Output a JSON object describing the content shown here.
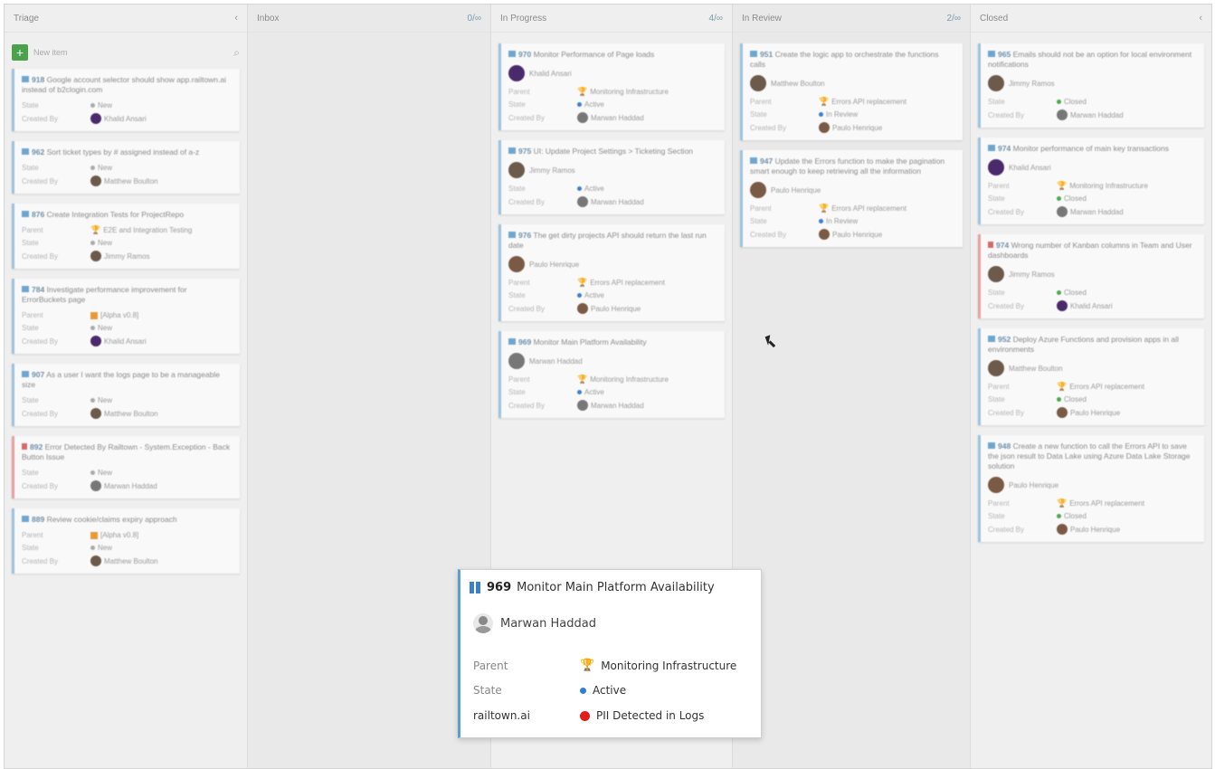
{
  "columns": [
    {
      "title": "Triage",
      "count": "",
      "chevron": "‹"
    },
    {
      "title": "Inbox",
      "count": "0/∞",
      "chevron": ""
    },
    {
      "title": "In Progress",
      "count": "4/∞",
      "chevron": ""
    },
    {
      "title": "In Review",
      "count": "2/∞",
      "chevron": ""
    },
    {
      "title": "Closed",
      "count": "",
      "chevron": "‹"
    }
  ],
  "new_item_label": "New item",
  "labels": {
    "parent": "Parent",
    "state": "State",
    "created_by": "Created By"
  },
  "triage_cards": [
    {
      "id": "918",
      "title": "Google account selector should show app.railtown.ai instead of b2clogin.com",
      "state": "New",
      "created_by": "Khalid Ansari"
    },
    {
      "id": "962",
      "title": "Sort ticket types by # assigned instead of a-z",
      "state": "New",
      "created_by": "Matthew Boulton"
    },
    {
      "id": "876",
      "title": "Create Integration Tests for ProjectRepo",
      "parent": "E2E and Integration Testing",
      "state": "New",
      "created_by": "Jimmy Ramos"
    },
    {
      "id": "784",
      "title": "Investigate performance improvement for ErrorBuckets page",
      "parent": "[Alpha v0.8]",
      "state": "New",
      "created_by": "Khalid Ansari"
    },
    {
      "id": "907",
      "title": "As a user I want the logs page to be a manageable size",
      "state": "New",
      "created_by": "Matthew Boulton"
    },
    {
      "id": "892",
      "title": "Error Detected By Railtown - System.Exception - Back Button Issue",
      "state": "New",
      "created_by": "Marwan Haddad",
      "bug": true
    },
    {
      "id": "889",
      "title": "Review cookie/claims expiry approach",
      "parent": "[Alpha v0.8]",
      "state": "New",
      "created_by": "Matthew Boulton"
    }
  ],
  "progress_cards": [
    {
      "id": "970",
      "title": "Monitor Performance of Page loads",
      "assignee": "Khalid Ansari",
      "parent": "Monitoring Infrastructure",
      "state": "Active",
      "created_by": "Marwan Haddad"
    },
    {
      "id": "975",
      "title": "UI: Update Project Settings > Ticketing Section",
      "assignee": "Jimmy Ramos",
      "state": "Active",
      "created_by": "Marwan Haddad"
    },
    {
      "id": "976",
      "title": "The get dirty projects API should return the last run date",
      "assignee": "Paulo Henrique",
      "parent": "Errors API replacement",
      "state": "Active",
      "created_by": "Paulo Henrique"
    },
    {
      "id": "969",
      "title": "Monitor Main Platform Availability",
      "assignee": "Marwan Haddad",
      "parent": "Monitoring Infrastructure",
      "state": "Active",
      "created_by": "Marwan Haddad"
    }
  ],
  "review_cards": [
    {
      "id": "951",
      "title": "Create the logic app to orchestrate the functions calls",
      "assignee": "Matthew Boulton",
      "parent": "Errors API replacement",
      "state": "In Review",
      "created_by": "Paulo Henrique"
    },
    {
      "id": "947",
      "title": "Update the Errors function to make the pagination smart enough to keep retrieving all the information",
      "assignee": "Paulo Henrique",
      "parent": "Errors API replacement",
      "state": "In Review",
      "created_by": "Paulo Henrique"
    }
  ],
  "closed_cards": [
    {
      "id": "965",
      "title": "Emails should not be an option for local environment notifications",
      "assignee": "Jimmy Ramos",
      "state": "Closed",
      "created_by": "Marwan Haddad"
    },
    {
      "id": "974",
      "title": "Monitor performance of main key transactions",
      "assignee": "Khalid Ansari",
      "parent": "Monitoring Infrastructure",
      "state": "Closed",
      "created_by": "Marwan Haddad"
    },
    {
      "id": "974",
      "title": "Wrong number of Kanban columns in Team and User dashboards",
      "assignee": "Jimmy Ramos",
      "state": "Closed",
      "created_by": "Khalid Ansari",
      "bug": true
    },
    {
      "id": "952",
      "title": "Deploy Azure Functions and provision apps in all environments",
      "assignee": "Matthew Boulton",
      "parent": "Errors API replacement",
      "state": "Closed",
      "created_by": "Paulo Henrique"
    },
    {
      "id": "948",
      "title": "Create a new function to call the Errors API to save the json result to Data Lake using Azure Data Lake Storage solution",
      "assignee": "Paulo Henrique",
      "parent": "Errors API replacement",
      "state": "Closed",
      "created_by": "Paulo Henrique"
    }
  ],
  "popup": {
    "id": "969",
    "title": "Monitor Main Platform Availability",
    "assignee": "Marwan Haddad",
    "parent_label": "Parent",
    "parent_value": "Monitoring Infrastructure",
    "state_label": "State",
    "state_value": "Active",
    "source_label": "railtown.ai",
    "source_value": "PII Detected in Logs"
  }
}
